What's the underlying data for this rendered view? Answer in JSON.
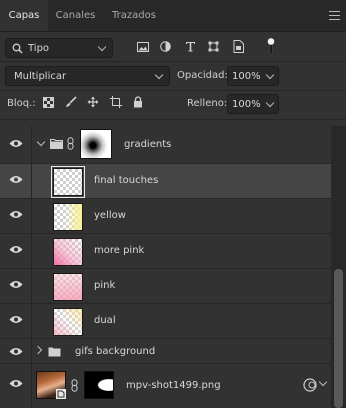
{
  "tabs": [
    {
      "label": "Capas",
      "active": true
    },
    {
      "label": "Canales",
      "active": false
    },
    {
      "label": "Trazados",
      "active": false
    }
  ],
  "filter": {
    "kind_label": "Tipo",
    "icons": [
      "image-filter-icon",
      "adjustment-filter-icon",
      "type-filter-icon",
      "shape-filter-icon",
      "smart-object-filter-icon",
      "filter-toggle-icon"
    ]
  },
  "blend": {
    "mode": "Multiplicar",
    "opacity_label": "Opacidad:",
    "opacity_value": "100%"
  },
  "lock": {
    "label": "Bloq.:",
    "icons": [
      "lock-transparent-pixels-icon",
      "lock-image-pixels-icon",
      "lock-position-icon",
      "lock-artboard-icon",
      "lock-all-icon"
    ],
    "fill_label": "Relleno:",
    "fill_value": "100%"
  },
  "layers": [
    {
      "name": "gradients",
      "type": "group",
      "expanded": true,
      "has_mask": true,
      "indent": 0,
      "selected": false
    },
    {
      "name": "final touches",
      "type": "layer",
      "indent": 1,
      "selected": true,
      "thumb": "transparent"
    },
    {
      "name": "yellow",
      "type": "layer",
      "indent": 1,
      "selected": false,
      "thumb": "yellow"
    },
    {
      "name": "more pink",
      "type": "layer",
      "indent": 1,
      "selected": false,
      "thumb": "more-pink"
    },
    {
      "name": "pink",
      "type": "layer",
      "indent": 1,
      "selected": false,
      "thumb": "pink"
    },
    {
      "name": "dual",
      "type": "layer",
      "indent": 1,
      "selected": false,
      "thumb": "dual"
    },
    {
      "name": "gifs background",
      "type": "group",
      "expanded": false,
      "indent": 0,
      "selected": false
    },
    {
      "name": "mpv-shot1499.png",
      "type": "smart",
      "has_mask": true,
      "indent": 0,
      "selected": false
    }
  ],
  "colors": {
    "panel_bg": "#323232",
    "tab_bar": "#282828",
    "selected_row": "#454545",
    "yellow_tint": "#fbf2a6",
    "pink_tint": "#f7a7c4",
    "text": "#d6d6d6"
  }
}
